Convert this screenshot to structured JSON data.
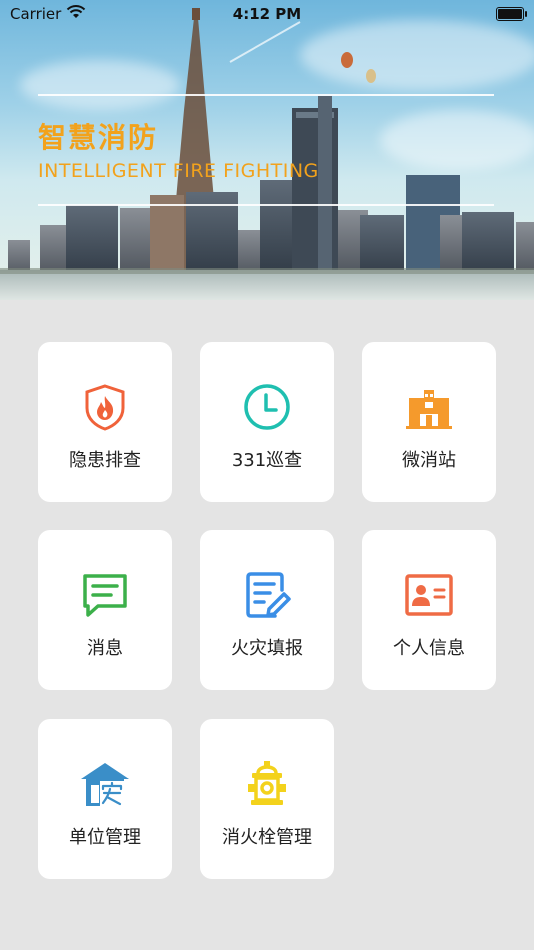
{
  "status_bar": {
    "carrier": "Carrier",
    "time": "4:12 PM"
  },
  "banner": {
    "title_cn": "智慧消防",
    "title_en": "INTELLIGENT FIRE FIGHTING"
  },
  "menu": [
    {
      "label": "隐患排查",
      "icon": "fire-shield-icon",
      "color": "#f0623a"
    },
    {
      "label": "331巡查",
      "icon": "clock-icon",
      "color": "#1fbfb0"
    },
    {
      "label": "微消站",
      "icon": "fire-station-icon",
      "color": "#f59a2c"
    },
    {
      "label": "消息",
      "icon": "message-icon",
      "color": "#3cb04a"
    },
    {
      "label": "火灾填报",
      "icon": "report-edit-icon",
      "color": "#3a8ee6"
    },
    {
      "label": "个人信息",
      "icon": "id-card-icon",
      "color": "#ef6b45"
    },
    {
      "label": "单位管理",
      "icon": "building-safety-icon",
      "color": "#3a8ec8"
    },
    {
      "label": "消火栓管理",
      "icon": "hydrant-icon",
      "color": "#f3d21c"
    }
  ]
}
